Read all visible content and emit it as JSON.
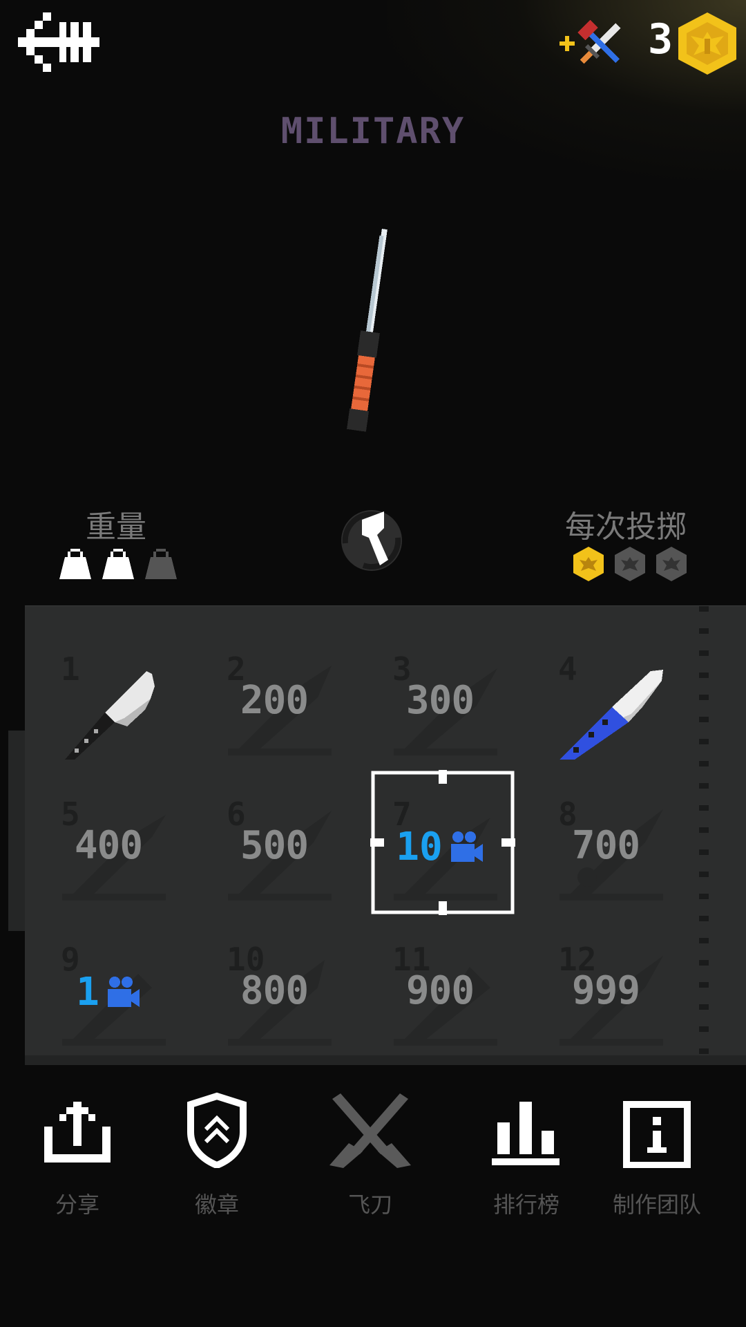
{
  "header": {
    "coins": "3",
    "weapon_name": "MILITARY"
  },
  "stats": {
    "weight_label": "重量",
    "weight_level": "2 of 3",
    "per_throw_label": "每次投掷",
    "per_throw_coins": "1 of 3"
  },
  "grid": {
    "slots": [
      {
        "num": "1",
        "price": "",
        "state": "unlocked"
      },
      {
        "num": "2",
        "price": "200",
        "state": "locked"
      },
      {
        "num": "3",
        "price": "300",
        "state": "locked"
      },
      {
        "num": "4",
        "price": "",
        "state": "unlocked"
      },
      {
        "num": "5",
        "price": "400",
        "state": "locked"
      },
      {
        "num": "6",
        "price": "500",
        "state": "locked"
      },
      {
        "num": "7",
        "price": "10",
        "state": "video",
        "selected": true
      },
      {
        "num": "8",
        "price": "700",
        "state": "locked"
      },
      {
        "num": "9",
        "price": "1",
        "state": "video"
      },
      {
        "num": "10",
        "price": "800",
        "state": "locked"
      },
      {
        "num": "11",
        "price": "900",
        "state": "locked"
      },
      {
        "num": "12",
        "price": "999",
        "state": "locked"
      }
    ]
  },
  "nav": {
    "share": "分享",
    "badges": "徽章",
    "knives": "飞刀",
    "leaderboard": "排行榜",
    "credits": "制作团队"
  },
  "colors": {
    "background": "#0a0a0a",
    "panel": "#2c2d2d",
    "title": "#5f4f6e",
    "gold": "#f2c21a",
    "video_blue": "#2f6fe6",
    "video_number": "#1aa0f0",
    "nav_label": "#555555"
  },
  "icons": {
    "back": "back-arrow-icon",
    "shop": "crossed-weapons-icon",
    "coin": "eagle-coin-icon",
    "weight": "weight-icon",
    "spin": "spin-icon",
    "video": "video-camera-icon",
    "share": "share-icon",
    "badges": "badge-shield-icon",
    "knives": "crossed-knives-icon",
    "leaderboard": "bar-chart-icon",
    "credits": "info-icon"
  }
}
